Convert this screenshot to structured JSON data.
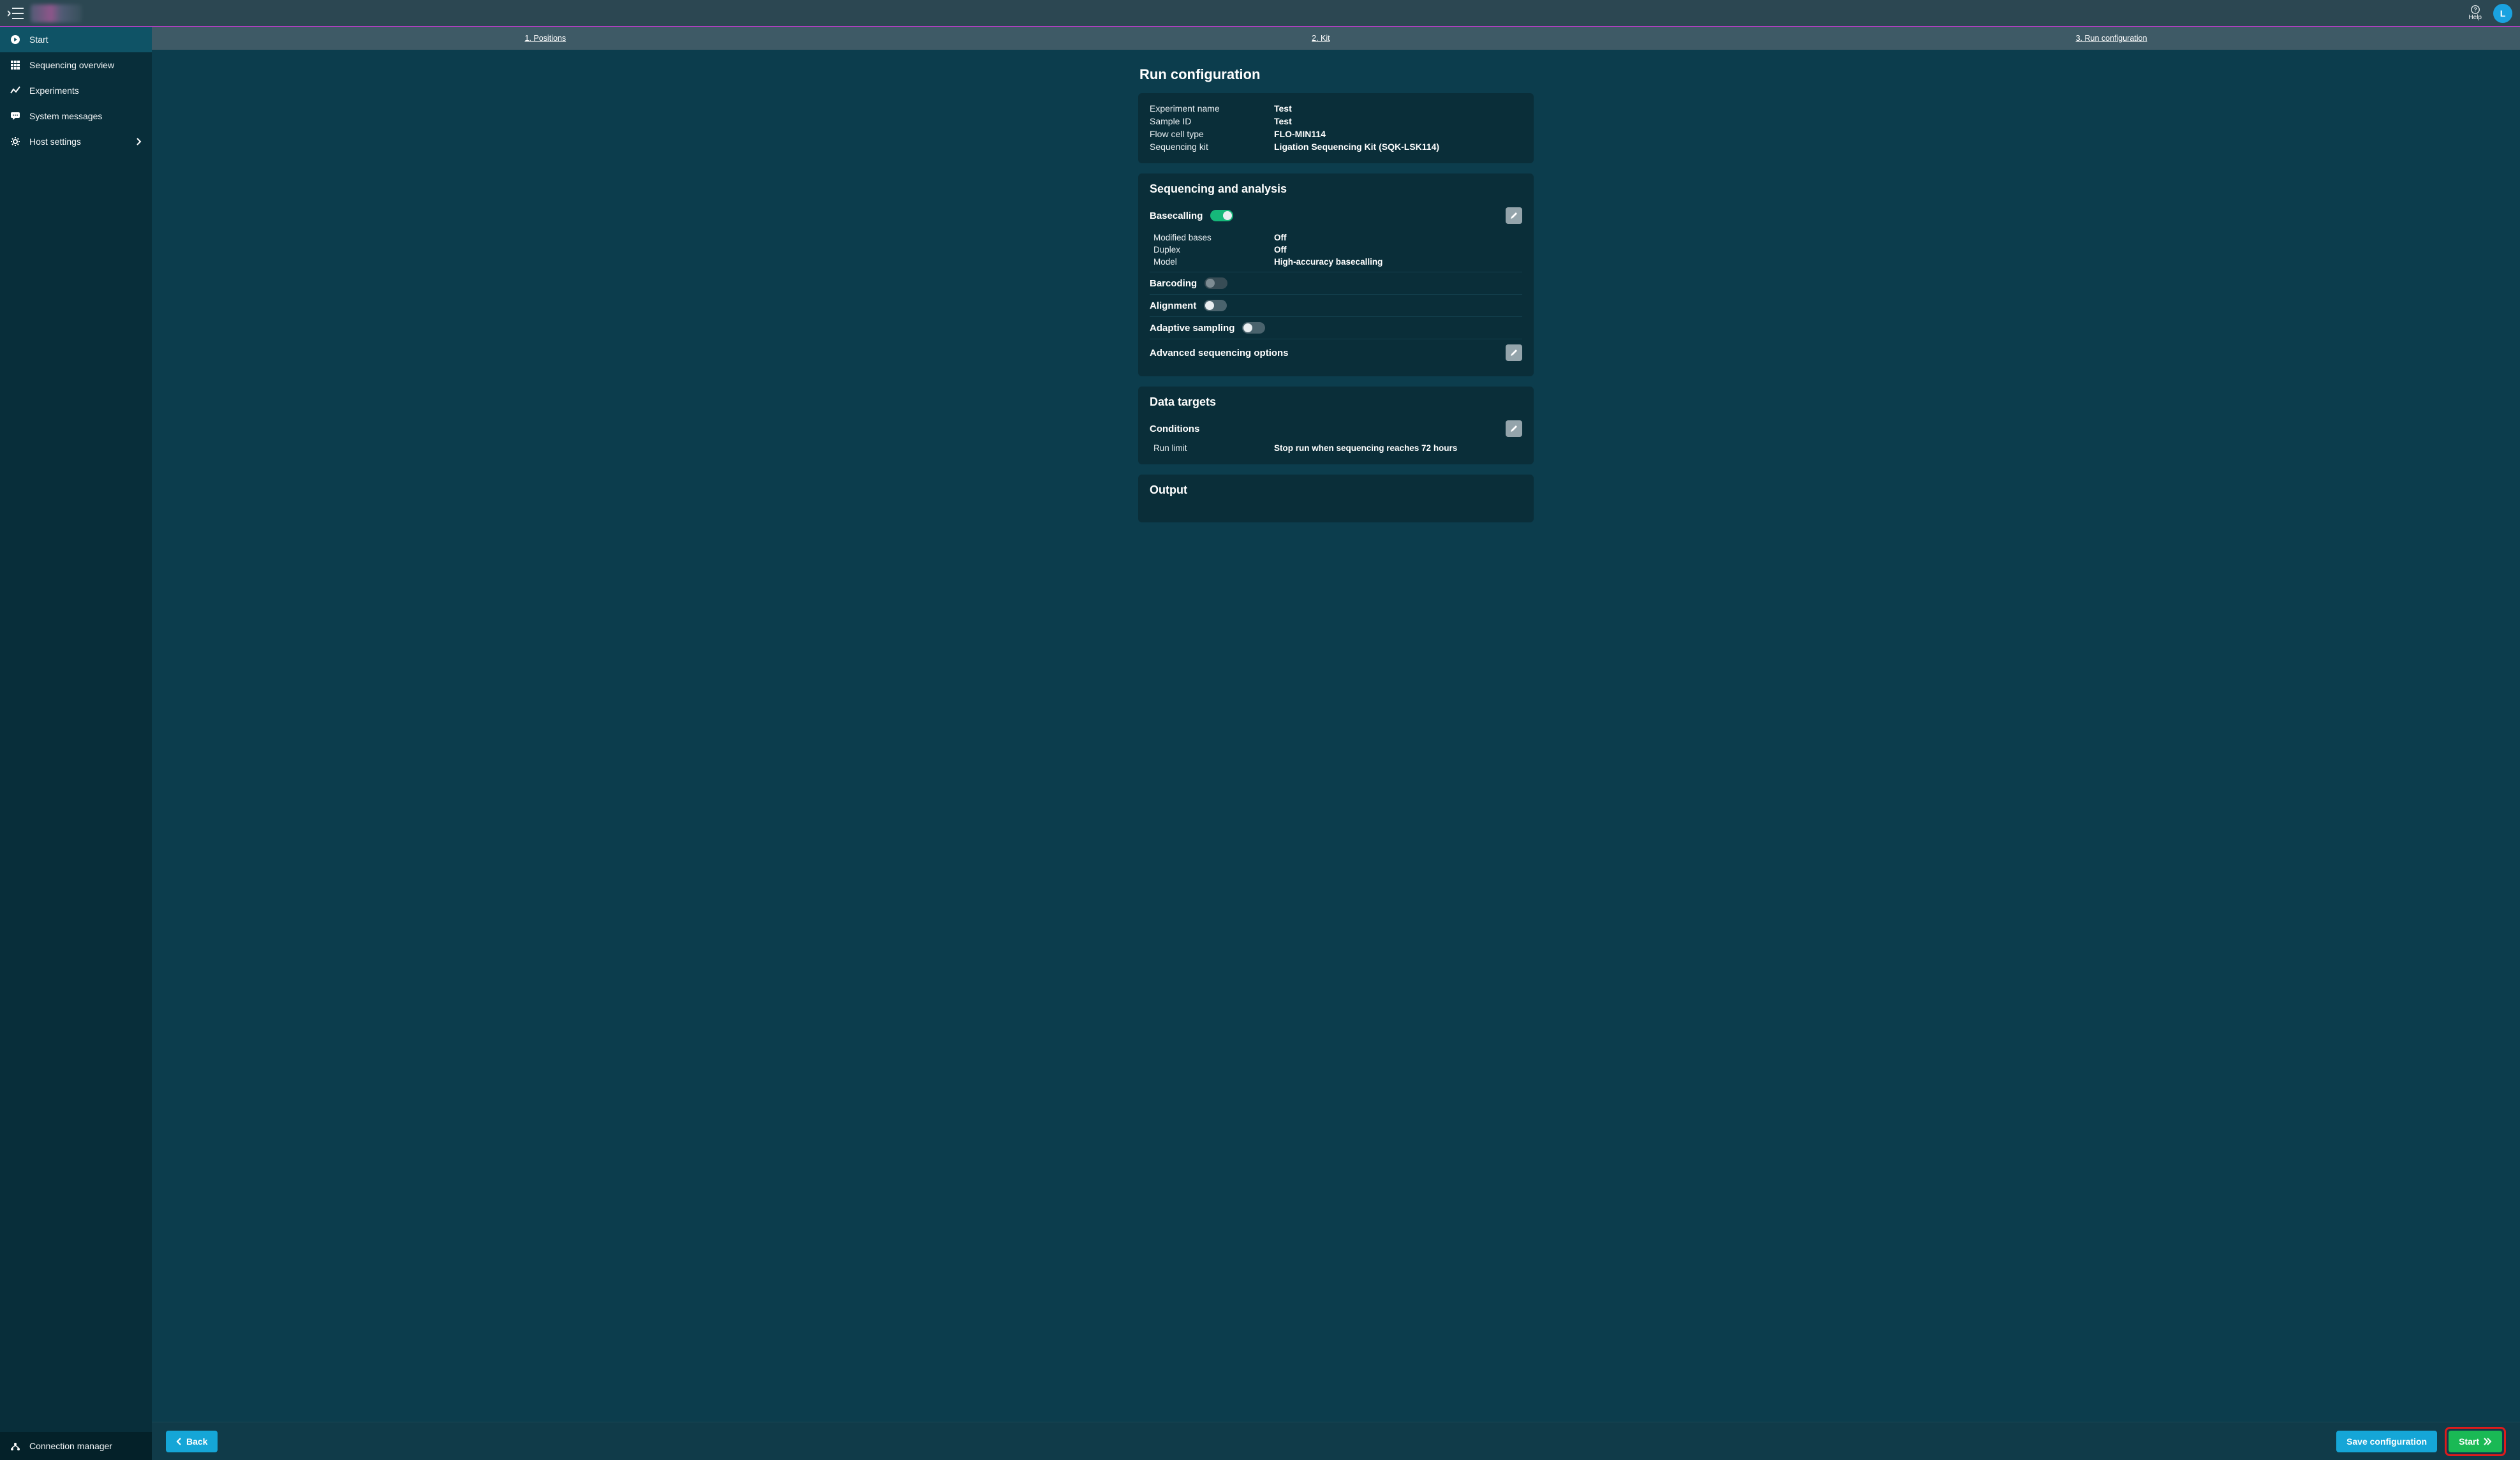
{
  "topbar": {
    "help_label": "Help",
    "avatar_initial": "L"
  },
  "sidebar": {
    "items": [
      {
        "label": "Start",
        "icon": "play"
      },
      {
        "label": "Sequencing overview",
        "icon": "grid"
      },
      {
        "label": "Experiments",
        "icon": "chart"
      },
      {
        "label": "System messages",
        "icon": "message"
      },
      {
        "label": "Host settings",
        "icon": "gear",
        "chevron": true
      }
    ],
    "bottom": {
      "label": "Connection manager",
      "icon": "hub"
    }
  },
  "steps": {
    "s1": "1. Positions",
    "s2": "2. Kit",
    "s3": "3. Run configuration"
  },
  "page": {
    "title": "Run configuration"
  },
  "summary": {
    "rows": [
      {
        "k": "Experiment name",
        "v": "Test"
      },
      {
        "k": "Sample ID",
        "v": "Test"
      },
      {
        "k": "Flow cell type",
        "v": "FLO-MIN114"
      },
      {
        "k": "Sequencing kit",
        "v": "Ligation Sequencing Kit (SQK-LSK114)"
      }
    ]
  },
  "seq_analysis": {
    "title": "Sequencing and analysis",
    "basecalling_label": "Basecalling",
    "basecalling_on": true,
    "basecalling_rows": [
      {
        "k": "Modified bases",
        "v": "Off"
      },
      {
        "k": "Duplex",
        "v": "Off"
      },
      {
        "k": "Model",
        "v": "High-accuracy basecalling"
      }
    ],
    "barcoding_label": "Barcoding",
    "barcoding_on": false,
    "alignment_label": "Alignment",
    "alignment_on": false,
    "adaptive_label": "Adaptive sampling",
    "adaptive_on": false,
    "advanced_label": "Advanced sequencing options"
  },
  "data_targets": {
    "title": "Data targets",
    "conditions_label": "Conditions",
    "run_limit_k": "Run limit",
    "run_limit_v": "Stop run when sequencing reaches 72 hours"
  },
  "output": {
    "title": "Output"
  },
  "footer": {
    "back": "Back",
    "save": "Save configuration",
    "start": "Start"
  }
}
